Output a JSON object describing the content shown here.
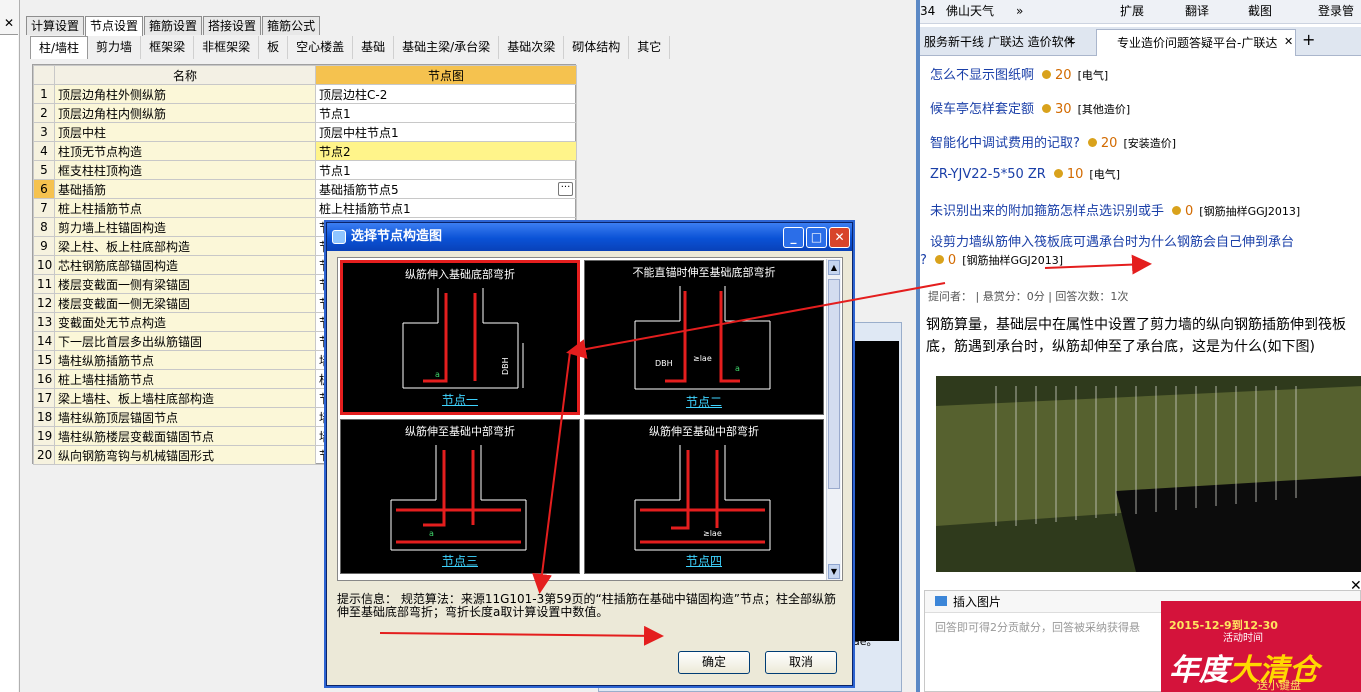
{
  "left": {
    "close_mark": "✕",
    "top_tabs": [
      "计算设置",
      "节点设置",
      "箍筋设置",
      "搭接设置",
      "箍筋公式"
    ],
    "active_top_tab": 1,
    "sub_tabs": [
      "柱/墙柱",
      "剪力墙",
      "框架梁",
      "非框架梁",
      "板",
      "空心楼盖",
      "基础",
      "基础主梁/承台梁",
      "基础次梁",
      "砌体结构",
      "其它"
    ],
    "grid": {
      "headers": [
        "",
        "名称",
        "节点图"
      ],
      "rows": [
        {
          "n": "1",
          "name": "顶层边角柱外侧纵筋",
          "val": "顶层边柱C-2"
        },
        {
          "n": "2",
          "name": "顶层边角柱内侧纵筋",
          "val": "节点1"
        },
        {
          "n": "3",
          "name": "顶层中柱",
          "val": "顶层中柱节点1"
        },
        {
          "n": "4",
          "name": "柱顶无节点构造",
          "val": "节点2"
        },
        {
          "n": "5",
          "name": "框支柱柱顶构造",
          "val": "节点1"
        },
        {
          "n": "6",
          "name": "基础插筋",
          "val": "基础插筋节点5"
        },
        {
          "n": "7",
          "name": "桩上柱插筋节点",
          "val": "桩上柱插筋节点1"
        },
        {
          "n": "8",
          "name": "剪力墙上柱锚固构造",
          "val": "节"
        },
        {
          "n": "9",
          "name": "梁上柱、板上柱底部构造",
          "val": "节"
        },
        {
          "n": "10",
          "name": "芯柱钢筋底部锚固构造",
          "val": "节"
        },
        {
          "n": "11",
          "name": "楼层变截面一侧有梁锚固",
          "val": "节"
        },
        {
          "n": "12",
          "name": "楼层变截面一侧无梁锚固",
          "val": "节"
        },
        {
          "n": "13",
          "name": "变截面处无节点构造",
          "val": "节"
        },
        {
          "n": "14",
          "name": "下一层比首层多出纵筋锚固",
          "val": "节"
        },
        {
          "n": "15",
          "name": "墙柱纵筋插筋节点",
          "val": "墙"
        },
        {
          "n": "16",
          "name": "桩上墙柱插筋节点",
          "val": "桩"
        },
        {
          "n": "17",
          "name": "梁上墙柱、板上墙柱底部构造",
          "val": "节"
        },
        {
          "n": "18",
          "name": "墙柱纵筋顶层锚固节点",
          "val": "墙"
        },
        {
          "n": "19",
          "name": "墙柱纵筋楼层变截面锚固节点",
          "val": "墙"
        },
        {
          "n": "20",
          "name": "纵向钢筋弯钩与机械锚固形式",
          "val": "节"
        }
      ]
    },
    "ellipsis": "···",
    "bg_text": "ae。"
  },
  "dialog": {
    "title": "选择节点构造图",
    "cells": [
      {
        "caption": "纵筋伸入基础底部弯折",
        "label": "节点一"
      },
      {
        "caption": "不能直锚时伸至基础底部弯折",
        "label": "节点二"
      },
      {
        "caption": "纵筋伸至基础中部弯折",
        "label": "节点三"
      },
      {
        "caption": "纵筋伸至基础中部弯折",
        "label": "节点四"
      }
    ],
    "hint": "提示信息： 规范算法：来源11G101-3第59页的“柱插筋在基础中锚固构造”节点；柱全部纵筋伸至基础底部弯折；弯折长度a取计算设置中数值。",
    "ok": "确定",
    "cancel": "取消",
    "min_glyph": "_",
    "max_glyph": "□",
    "close_glyph": "✕"
  },
  "browser": {
    "bar_items": [
      "34",
      "佛山天气",
      "»",
      "扩展",
      "翻译",
      "截图",
      "登录管"
    ],
    "tabs": [
      "服务新干线 广联达 造价软件",
      "专业造价问题答疑平台-广联达"
    ],
    "tab_close": "✕",
    "tab_new": "+",
    "questions": [
      {
        "title": "怎么不显示图纸啊",
        "points": "20",
        "cat": "[电气]"
      },
      {
        "title": "候车亭怎样套定额",
        "points": "30",
        "cat": "[其他造价]"
      },
      {
        "title": "智能化中调试费用的记取?",
        "points": "20",
        "cat": "[安装造价]"
      },
      {
        "title": "ZR-YJV22-5*50 ZR",
        "points": "10",
        "cat": "[电气]"
      },
      {
        "title": "未识别出来的附加箍筋怎样点选识别或手",
        "points": "0",
        "cat": "[钢筋抽样GGJ2013]"
      },
      {
        "title": "设剪力墙纵筋伸入筏板底可遇承台时为什么钢筋会自己伸到承台",
        "points": "0",
        "cat": "[钢筋抽样GGJ2013]"
      }
    ],
    "q_suffix": "?",
    "meta": "提问者：    |  悬赏分：0分   |  回答次数：1次",
    "question_text": "钢筋算量，基础层中在属性中设置了剪力墙的纵向钢筋插筋伸到筏板底，筋遇到承台时，纵筋却伸至了承台底，这是为什么(如下图)",
    "insert_image": "插入图片",
    "placeholder": "回答即可得2分贡献分，回答被采纳获得悬",
    "ad": {
      "date": "2015-12-9到12-30",
      "sub": "活动时间",
      "big1": "年度",
      "big2": "大清仓",
      "small": "送小键盘"
    },
    "close": "✕"
  },
  "colors": {
    "accent": "#0a52d6",
    "highlight": "#fff48a",
    "header_orange": "#f5c24f",
    "rebar_red": "#e41e1e",
    "link": "#1a3fa8"
  }
}
